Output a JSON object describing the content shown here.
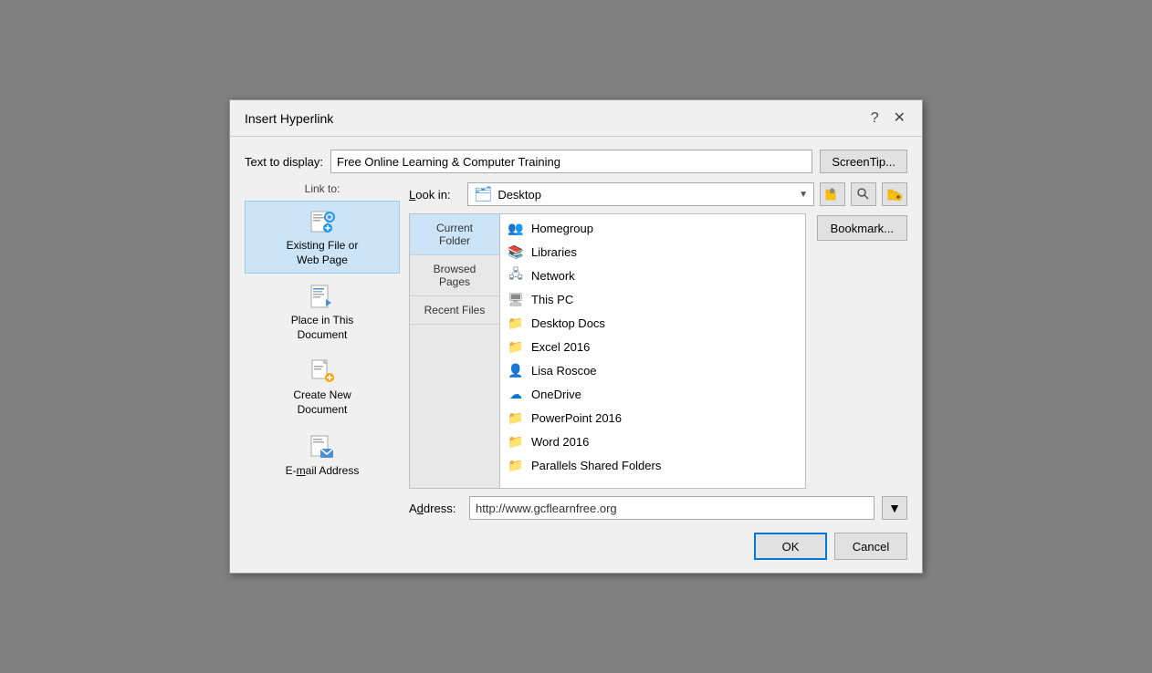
{
  "dialog": {
    "title": "Insert Hyperlink",
    "help_btn": "?",
    "close_btn": "✕"
  },
  "header": {
    "text_to_display_label": "Text to display:",
    "text_to_display_value": "Free Online Learning & Computer Training",
    "screentip_btn": "ScreenTip..."
  },
  "link_to": {
    "label": "Link to:",
    "items": [
      {
        "id": "existing",
        "label": "Existing File or\nWeb Page",
        "icon": "web"
      },
      {
        "id": "place",
        "label": "Place in This\nDocument",
        "icon": "doc"
      },
      {
        "id": "new",
        "label": "Create New\nDocument",
        "icon": "new-doc"
      },
      {
        "id": "email",
        "label": "E-mail Address",
        "icon": "email"
      }
    ]
  },
  "look_in": {
    "label": "Look in:",
    "value": "Desktop"
  },
  "nav_items": [
    {
      "id": "current",
      "label": "Current\nFolder",
      "active": true
    },
    {
      "id": "browsed",
      "label": "Browsed\nPages",
      "active": false
    },
    {
      "id": "recent",
      "label": "Recent Files",
      "active": false
    }
  ],
  "file_list": [
    {
      "name": "Homegroup",
      "icon": "homegroup"
    },
    {
      "name": "Libraries",
      "icon": "library"
    },
    {
      "name": "Network",
      "icon": "network"
    },
    {
      "name": "This PC",
      "icon": "pc"
    },
    {
      "name": "Desktop Docs",
      "icon": "folder"
    },
    {
      "name": "Excel 2016",
      "icon": "folder"
    },
    {
      "name": "Lisa Roscoe",
      "icon": "user"
    },
    {
      "name": "OneDrive",
      "icon": "onedrive"
    },
    {
      "name": "PowerPoint 2016",
      "icon": "folder"
    },
    {
      "name": "Word 2016",
      "icon": "folder"
    },
    {
      "name": "Parallels Shared Folders",
      "icon": "parallels"
    }
  ],
  "right_buttons": {
    "bookmark_btn": "Bookmark..."
  },
  "address": {
    "label": "Address:",
    "value": "http://www.gcflearnfree.org"
  },
  "bottom": {
    "ok_btn": "OK",
    "cancel_btn": "Cancel"
  }
}
